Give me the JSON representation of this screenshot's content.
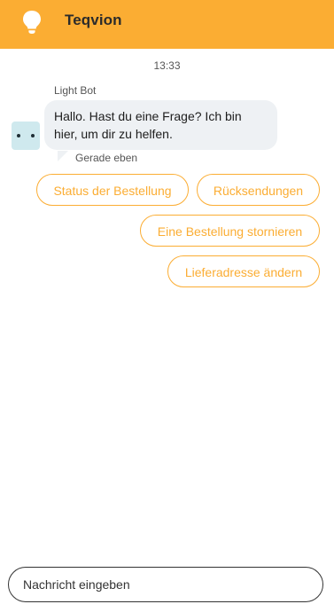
{
  "theme": {
    "brand_color": "#fbad33",
    "bubble_color": "#eef1f4",
    "avatar_color": "#cfe9ee"
  },
  "header": {
    "icon": "lightbulb-icon",
    "title": "Teqvion"
  },
  "conversation": {
    "timestamp": "13:33",
    "messages": [
      {
        "sender": "Light Bot",
        "avatar_icon": "bot-avatar-icon",
        "text": "Hallo. Hast du eine Frage? Ich bin hier, um dir zu helfen.",
        "sent_label": "Gerade eben"
      }
    ],
    "quick_replies": [
      "Status der Bestellung",
      "Rücksendungen",
      "Eine Bestellung stornieren",
      "Lieferadresse ändern"
    ]
  },
  "composer": {
    "placeholder": "Nachricht eingeben",
    "value": ""
  }
}
